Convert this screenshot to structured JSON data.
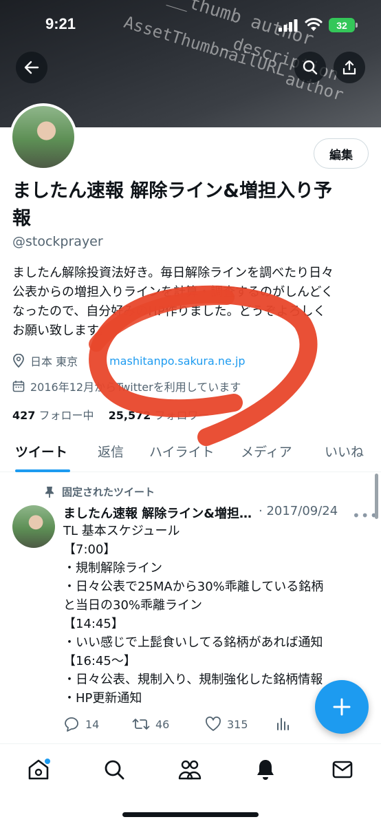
{
  "status_bar": {
    "time": "9:21",
    "battery": "32"
  },
  "banner": {
    "code_lines": [
      "__thumb   author",
      "AssetThumbnailURL",
      "_description",
      "author"
    ]
  },
  "icons": {
    "back": "arrow-left-icon",
    "search": "search-icon",
    "share": "share-icon",
    "location": "location-pin-icon",
    "calendar": "calendar-icon",
    "pin": "pin-icon",
    "reply": "reply-icon",
    "retweet": "retweet-icon",
    "like": "heart-icon",
    "views": "bar-chart-icon",
    "compose": "plus-icon"
  },
  "profile": {
    "edit_label": "編集",
    "name_line1": "ましたん速報 解除ライン&増担入り予",
    "name_line2": "報",
    "handle": "@stockprayer",
    "bio": [
      "ましたん解除投資法好き。毎日解除ラインを調べたり日々",
      "公表からの増担入りラインを計算・調査するのがしんどく",
      "なったので、自分好みのHP作りました。どうぞよろしく",
      "お願い致します。"
    ],
    "location": "日本 東京",
    "website": "mashitanpo.sakura.ne.jp",
    "joined": "2016年12月からTwitterを利用しています",
    "following_count": "427",
    "following_label": "フォロー中",
    "followers_count": "25,572",
    "followers_label": "フォロワー"
  },
  "tabs": [
    "ツイート",
    "返信",
    "ハイライト",
    "メディア",
    "いいね"
  ],
  "tweet": {
    "pinned_label": "固定されたツイート",
    "name": "ましたん速報 解除ライン&増担入り予報",
    "date": "· 2017/09/24",
    "body": [
      "TL 基本スケジュール",
      "【7:00】",
      "・規制解除ライン",
      "・日々公表で25MAから30%乖離している銘柄",
      "と当日の30%乖離ライン",
      "【14:45】",
      "・いい感じで上髭食いしてる銘柄があれば通知",
      "【16:45〜】",
      "・日々公表、規制入り、規制強化した銘柄情報",
      "・HP更新通知"
    ],
    "replies": "14",
    "retweets": "46",
    "likes": "315"
  },
  "bottom_nav": [
    "home-icon",
    "search-icon",
    "communities-icon",
    "bell-icon",
    "mail-icon"
  ],
  "colors": {
    "accent": "#1d9bf0",
    "annotation": "#e8472b",
    "text": "#0f1419",
    "muted": "#536471"
  }
}
